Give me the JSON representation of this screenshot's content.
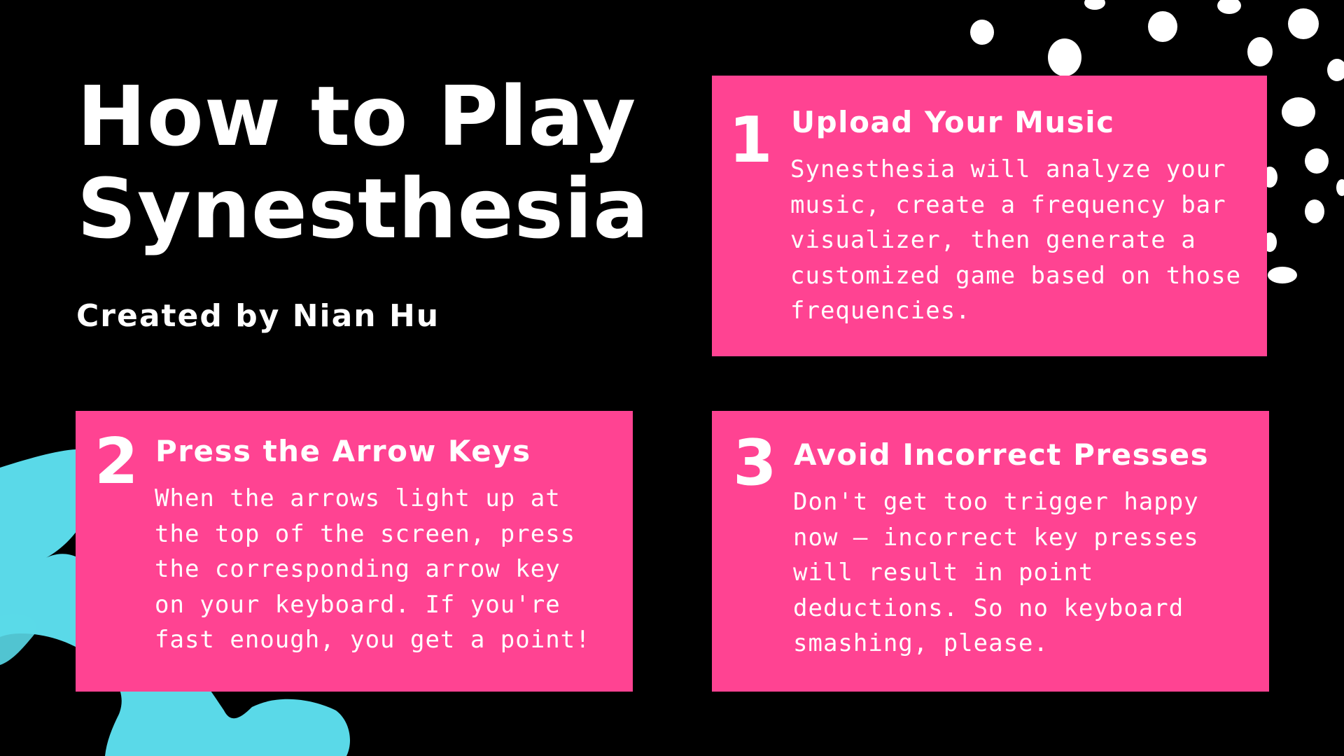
{
  "title_lines": [
    "How to Play",
    "Synesthesia"
  ],
  "subtitle": "Created by Nian Hu",
  "colors": {
    "background": "#000000",
    "card": "#ff4392",
    "text": "#ffffff",
    "brush_stroke": "#5ad9e8",
    "dots": "#ffffff"
  },
  "steps": [
    {
      "number": "1",
      "heading": "Upload Your Music",
      "body_lines": [
        "Synesthesia will analyze your",
        "music, create a frequency bar",
        "visualizer, then generate a",
        "customized game based on those",
        "frequencies."
      ]
    },
    {
      "number": "2",
      "heading": "Press the Arrow Keys",
      "body_lines": [
        "When the arrows light up at",
        "the top of the screen, press",
        "the corresponding arrow key",
        "on your keyboard. If you're",
        "fast enough, you get a point!"
      ]
    },
    {
      "number": "3",
      "heading": "Avoid Incorrect Presses",
      "body_lines": [
        "Don't get too trigger happy",
        "now — incorrect key presses",
        "will result in point",
        "deductions. So no keyboard",
        "smashing, please."
      ]
    }
  ],
  "decorations": {
    "top_right": "white-dot-pattern",
    "bottom_left": "cyan-brush-stroke"
  }
}
